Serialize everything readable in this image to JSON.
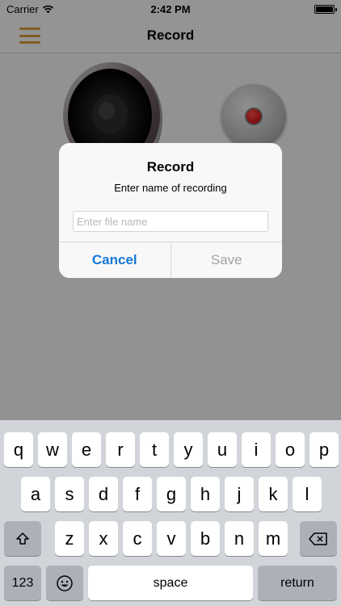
{
  "status_bar": {
    "carrier": "Carrier",
    "time": "2:42 PM",
    "battery_level": 1.0
  },
  "nav": {
    "title": "Record",
    "menu_icon": "hamburger-menu-icon"
  },
  "content": {
    "speaker_icon": "speaker-icon",
    "record_icon": "record-button-icon"
  },
  "alert": {
    "title": "Record",
    "message": "Enter name of recording",
    "input_placeholder": "Enter file name",
    "input_value": "",
    "cancel_label": "Cancel",
    "save_label": "Save"
  },
  "keyboard": {
    "row1": [
      "q",
      "w",
      "e",
      "r",
      "t",
      "y",
      "u",
      "i",
      "o",
      "p"
    ],
    "row2": [
      "a",
      "s",
      "d",
      "f",
      "g",
      "h",
      "j",
      "k",
      "l"
    ],
    "row3": [
      "z",
      "x",
      "c",
      "v",
      "b",
      "n",
      "m"
    ],
    "numbers_label": "123",
    "space_label": "space",
    "return_label": "return"
  },
  "colors": {
    "accent": "#1677d6",
    "menu": "#d99a3a",
    "record_red": "#d00000"
  }
}
